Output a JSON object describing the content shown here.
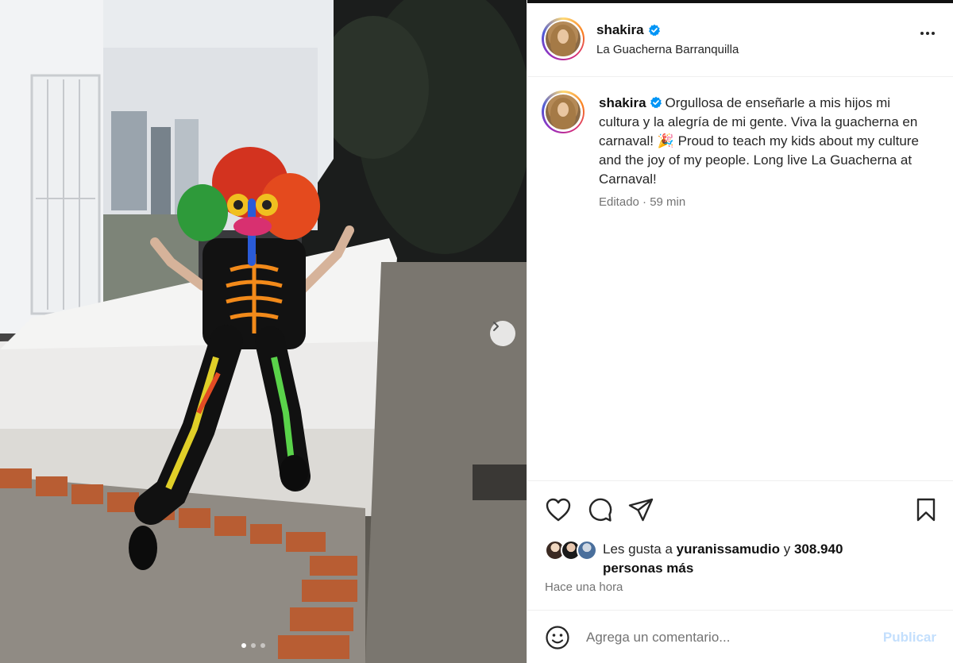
{
  "post": {
    "username": "shakira",
    "location": "La Guacherna Barranquilla",
    "caption_text": "Orgullosa de enseñarle a mis hijos mi cultura y la alegría de mi gente. Viva la guacherna en carnaval! 🎉 Proud to teach my kids about my culture and the joy of my people. Long live La Guacherna at Carnaval!",
    "caption_meta": "Editado · 59 min",
    "verified_icon": "verified-badge-icon",
    "carousel": {
      "total_slides": 3,
      "active_slide": 1
    }
  },
  "likes": {
    "prefix": "Les gusta a ",
    "user": "yuranissamudio",
    "middle": " y ",
    "count": "308.940",
    "suffix": "personas más",
    "time": "Hace una hora"
  },
  "comment": {
    "placeholder": "Agrega un comentario...",
    "publish_label": "Publicar"
  },
  "colors": {
    "verified": "#0095f6",
    "publish_disabled": "#c3dffd",
    "meta_gray": "#737373"
  },
  "icons": [
    "heart-icon",
    "comment-icon",
    "share-icon",
    "bookmark-icon",
    "emoji-icon",
    "chevron-right-icon",
    "more-options-icon"
  ]
}
